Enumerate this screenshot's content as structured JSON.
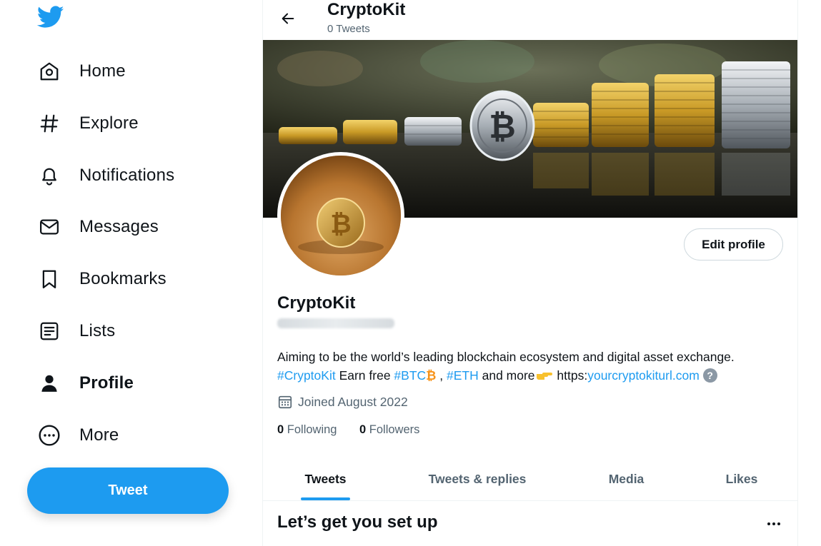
{
  "sidebar": {
    "logo": "twitter-bird-icon",
    "items": [
      {
        "label": "Home",
        "icon": "home-icon"
      },
      {
        "label": "Explore",
        "icon": "hashtag-icon"
      },
      {
        "label": "Notifications",
        "icon": "bell-icon"
      },
      {
        "label": "Messages",
        "icon": "envelope-icon"
      },
      {
        "label": "Bookmarks",
        "icon": "bookmark-icon"
      },
      {
        "label": "Lists",
        "icon": "list-icon"
      },
      {
        "label": "Profile",
        "icon": "person-icon",
        "active": true
      },
      {
        "label": "More",
        "icon": "more-circle-icon"
      }
    ],
    "tweet_button": "Tweet"
  },
  "header": {
    "title": "CryptoKit",
    "subtitle": "0 Tweets"
  },
  "profile": {
    "edit_button": "Edit profile",
    "name": "CryptoKit",
    "bio_line1": "Aiming to be the world’s leading blockchain ecosystem and digital asset exchange.",
    "bio_tag1": "#CryptoKit",
    "bio_text1": " Earn free ",
    "bio_tag2": "#BTC",
    "bio_btc_emoji": "₿",
    "bio_text2": " , ",
    "bio_tag3": "#ETH",
    "bio_text3": " and more",
    "bio_point_emoji": "👉",
    "bio_text4": " https:",
    "bio_url": "yourcryptokiturl.com",
    "bio_help": "?",
    "joined": "Joined August 2022",
    "following_count": "0",
    "following_label": "Following",
    "followers_count": "0",
    "followers_label": "Followers"
  },
  "tabs": [
    "Tweets",
    "Tweets & replies",
    "Media",
    "Likes"
  ],
  "active_tab": 0,
  "setup": {
    "title": "Let’s get you set up"
  },
  "colors": {
    "accent": "#1d9bf0",
    "text": "#0f1419",
    "secondary": "#536471",
    "bitcoin": "#f7931a"
  }
}
